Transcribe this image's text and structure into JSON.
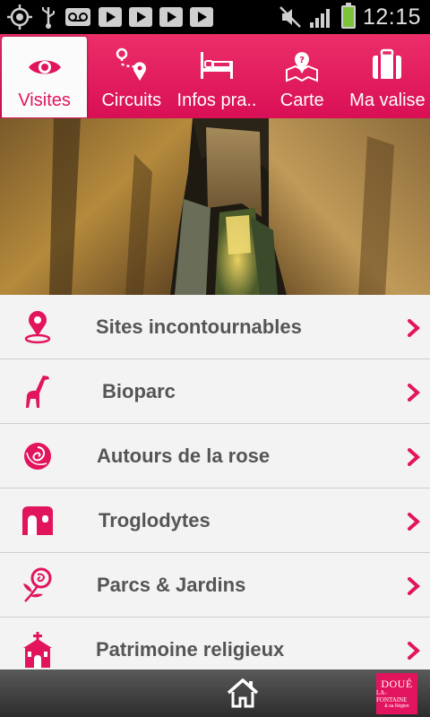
{
  "status_bar": {
    "time": "12:15",
    "icons_left": [
      "gps-icon",
      "usb-icon",
      "voicemail-icon",
      "media-play-icon",
      "media-play-icon",
      "media-play-icon",
      "media-play-icon"
    ],
    "icons_right": [
      "mute-icon",
      "signal-icon",
      "battery-charging-icon"
    ]
  },
  "tabs": [
    {
      "label": "Visites",
      "icon": "eye-icon",
      "active": true
    },
    {
      "label": "Circuits",
      "icon": "route-icon",
      "active": false
    },
    {
      "label": "Infos pra..",
      "icon": "bed-icon",
      "active": false
    },
    {
      "label": "Carte",
      "icon": "map-icon",
      "active": false
    },
    {
      "label": "Ma valise",
      "icon": "suitcase-icon",
      "active": false
    }
  ],
  "menu": [
    {
      "label": "Sites incontournables",
      "icon": "location-pin-icon"
    },
    {
      "label": "Bioparc",
      "icon": "giraffe-icon"
    },
    {
      "label": "Autours de la rose",
      "icon": "rose-icon"
    },
    {
      "label": "Troglodytes",
      "icon": "cave-dwelling-icon"
    },
    {
      "label": "Parcs & Jardins",
      "icon": "flower-icon"
    },
    {
      "label": "Patrimoine religieux",
      "icon": "church-icon"
    }
  ],
  "bottom_bar": {
    "home_icon": "home-icon",
    "logo_text": "DOUÉ",
    "logo_sub": "LA-FONTAINE",
    "logo_sub2": "& sa Région"
  },
  "colors": {
    "accent": "#e2145e",
    "tab_bar": "#e22462",
    "label_text": "#555555",
    "status_bar": "#000000"
  }
}
